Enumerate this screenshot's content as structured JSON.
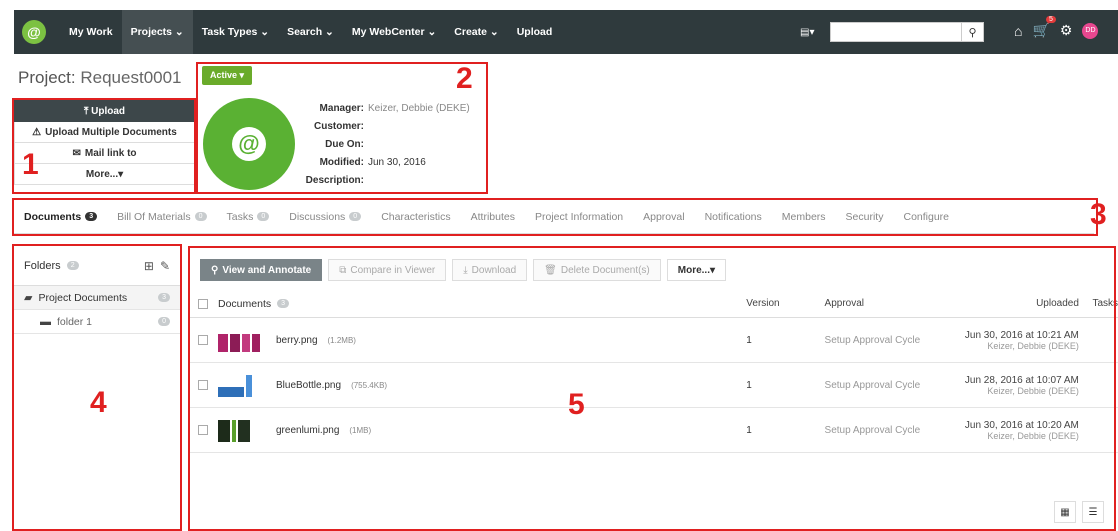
{
  "nav": {
    "items": [
      "My Work",
      "Projects ⌄",
      "Task Types ⌄",
      "Search ⌄",
      "My WebCenter ⌄",
      "Create ⌄",
      "Upload"
    ],
    "active_index": 1,
    "search_type": "▤▾",
    "cart_count": "5",
    "avatar": "DD"
  },
  "project": {
    "label": "Project:",
    "name": "Request0001",
    "status": "Active ▾"
  },
  "actions": {
    "upload": "⤒ Upload",
    "upload_multiple": "Upload Multiple Documents",
    "mail_link": "Mail link to",
    "more": "More...▾"
  },
  "info": {
    "manager_label": "Manager:",
    "manager_value": "Keizer, Debbie (DEKE)",
    "customer_label": "Customer:",
    "due_label": "Due On:",
    "modified_label": "Modified:",
    "modified_value": "Jun 30, 2016",
    "description_label": "Description:"
  },
  "tabs": [
    {
      "label": "Documents",
      "badge": "3"
    },
    {
      "label": "Bill Of Materials",
      "badge": "0"
    },
    {
      "label": "Tasks",
      "badge": "0"
    },
    {
      "label": "Discussions",
      "badge": "0"
    },
    {
      "label": "Characteristics"
    },
    {
      "label": "Attributes"
    },
    {
      "label": "Project Information"
    },
    {
      "label": "Approval"
    },
    {
      "label": "Notifications"
    },
    {
      "label": "Members"
    },
    {
      "label": "Security"
    },
    {
      "label": "Configure"
    }
  ],
  "folders": {
    "title": "Folders",
    "count": "2",
    "root": {
      "name": "Project Documents",
      "count": "3"
    },
    "child": {
      "name": "folder 1",
      "count": "0"
    }
  },
  "toolbar": {
    "view_annotate": "View and Annotate",
    "compare": "Compare in Viewer",
    "download": "Download",
    "delete": "Delete Document(s)",
    "more": "More...▾"
  },
  "table": {
    "headers": {
      "documents": "Documents",
      "documents_count": "3",
      "version": "Version",
      "approval": "Approval",
      "uploaded": "Uploaded",
      "tasks": "Tasks"
    },
    "rows": [
      {
        "name": "berry.png",
        "size": "(1.2MB)",
        "version": "1",
        "approval": "Setup Approval Cycle",
        "date": "Jun 30, 2016 at 10:21 AM",
        "user": "Keizer, Debbie (DEKE)"
      },
      {
        "name": "BlueBottle.png",
        "size": "(755.4KB)",
        "version": "1",
        "approval": "Setup Approval Cycle",
        "date": "Jun 28, 2016 at 10:07 AM",
        "user": "Keizer, Debbie (DEKE)"
      },
      {
        "name": "greenlumi.png",
        "size": "(1MB)",
        "version": "1",
        "approval": "Setup Approval Cycle",
        "date": "Jun 30, 2016 at 10:20 AM",
        "user": "Keizer, Debbie (DEKE)"
      }
    ]
  },
  "annotations": [
    "1",
    "2",
    "3",
    "4",
    "5"
  ],
  "colors": {
    "annotation": "#e02020",
    "nav_bg": "#2f3a3d",
    "brand_green": "#6aab2a"
  }
}
